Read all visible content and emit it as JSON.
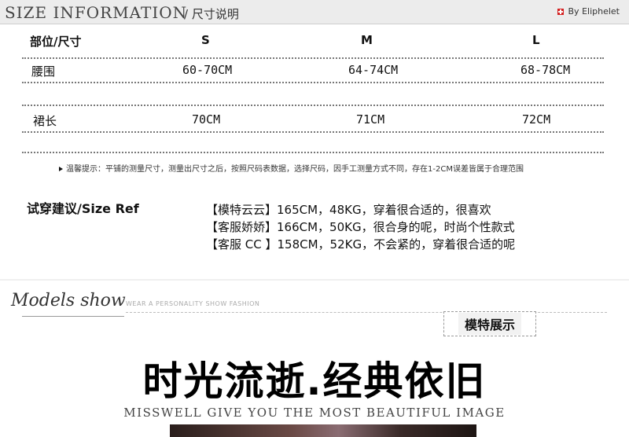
{
  "header": {
    "title_en": "SIZE INFORMATION",
    "title_cn": "/ 尺寸说明",
    "brand": "By Eliphelet"
  },
  "size_table": {
    "columns": [
      "部位/尺寸",
      "S",
      "M",
      "L"
    ],
    "rows": [
      {
        "label": "腰围",
        "values": [
          "60-70CM",
          "64-74CM",
          "68-78CM"
        ]
      },
      {
        "label": "裙长",
        "values": [
          "70CM",
          "71CM",
          "72CM"
        ]
      }
    ]
  },
  "note": "温馨提示：平铺的测量尺寸，测量出尺寸之后，按照尺码表数据，选择尺码，因手工测量方式不同，存在1-2CM误差皆属于合理范围",
  "try_on": {
    "label": "试穿建议/Size Ref",
    "lines": [
      "【模特云云】165CM，48KG，穿着很合适的，很喜欢",
      "【客服娇娇】166CM，50KG，很合身的呢，时尚个性款式",
      "【客服 CC 】158CM，52KG，不会紧的，穿着很合适的呢"
    ]
  },
  "models": {
    "script_title": "Models show",
    "subtitle": "WEAR A PERSONALITY SHOW FASHION",
    "badge": "模特展示",
    "headline": "时光流逝.经典依旧",
    "tagline": "MISSWELL GIVE YOU THE MOST BEAUTIFUL IMAGE"
  }
}
